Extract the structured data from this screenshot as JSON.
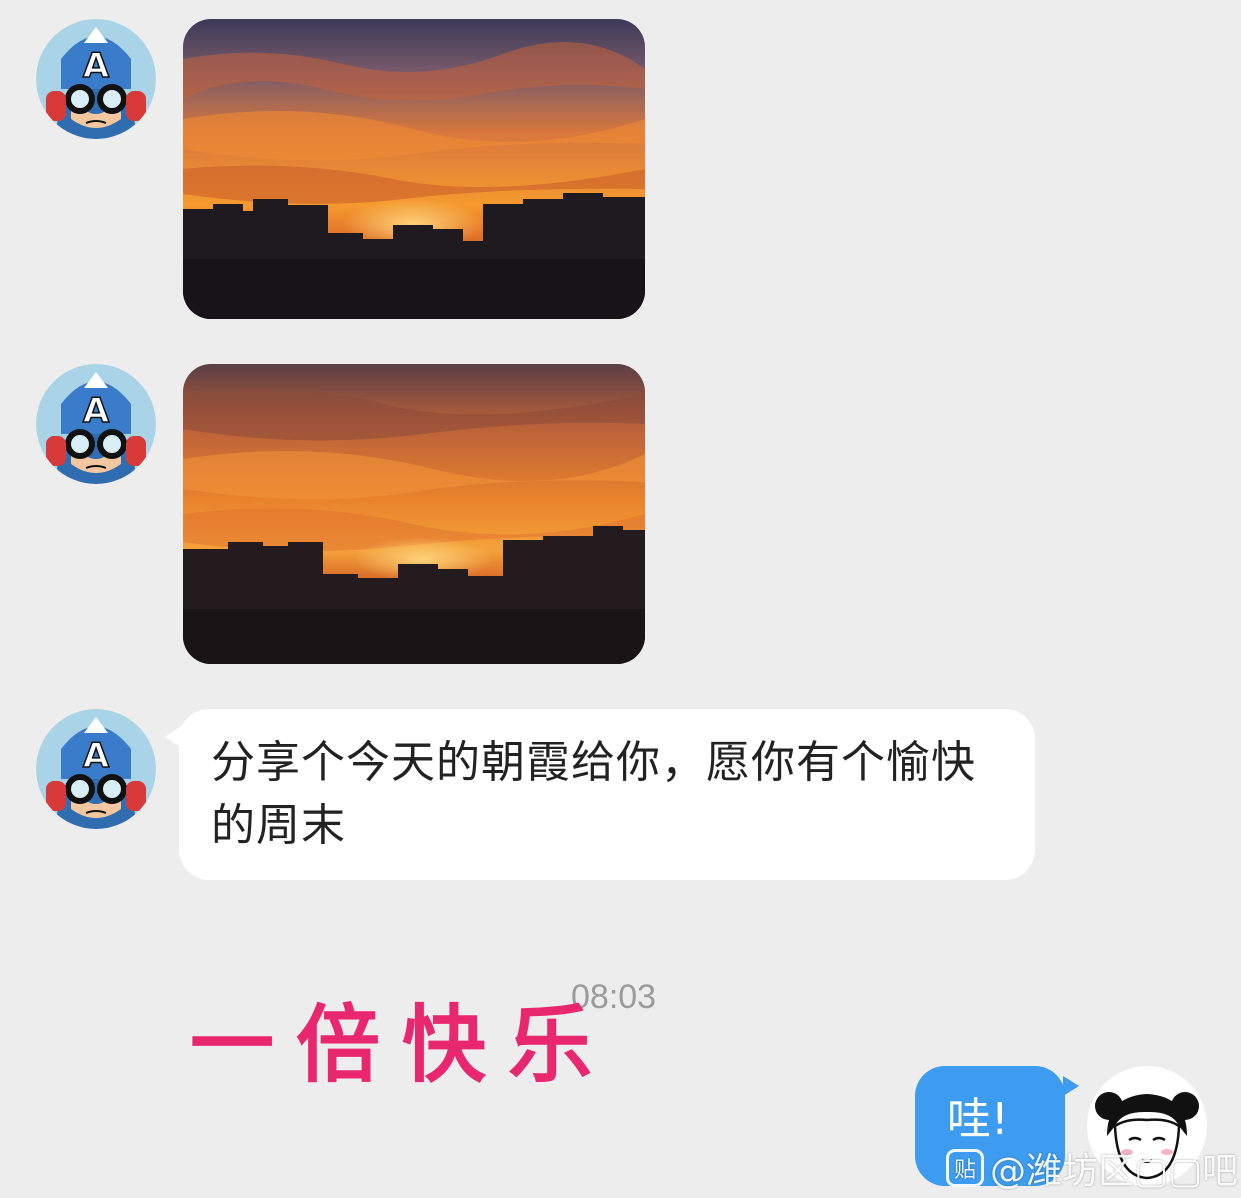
{
  "messages": [
    {
      "type": "image",
      "sender": "friend",
      "alt": "朝霞"
    },
    {
      "type": "image",
      "sender": "friend",
      "alt": "朝霞"
    },
    {
      "type": "text",
      "sender": "friend",
      "text": "分享个今天的朝霞给你，愿你有个愉快的周末"
    }
  ],
  "timestamp": "08:03",
  "sticker": {
    "text": "一倍快乐",
    "color": "#e8276f"
  },
  "reply": {
    "text": "哇!",
    "sender": "me"
  },
  "watermark": {
    "icon_glyph": "贴",
    "text": "@潍坊区▢▢吧"
  },
  "colors": {
    "background": "#ededed",
    "incoming_bubble": "#ffffff",
    "outgoing_bubble": "#3d9cf0",
    "timestamp": "#9b9b9b"
  }
}
